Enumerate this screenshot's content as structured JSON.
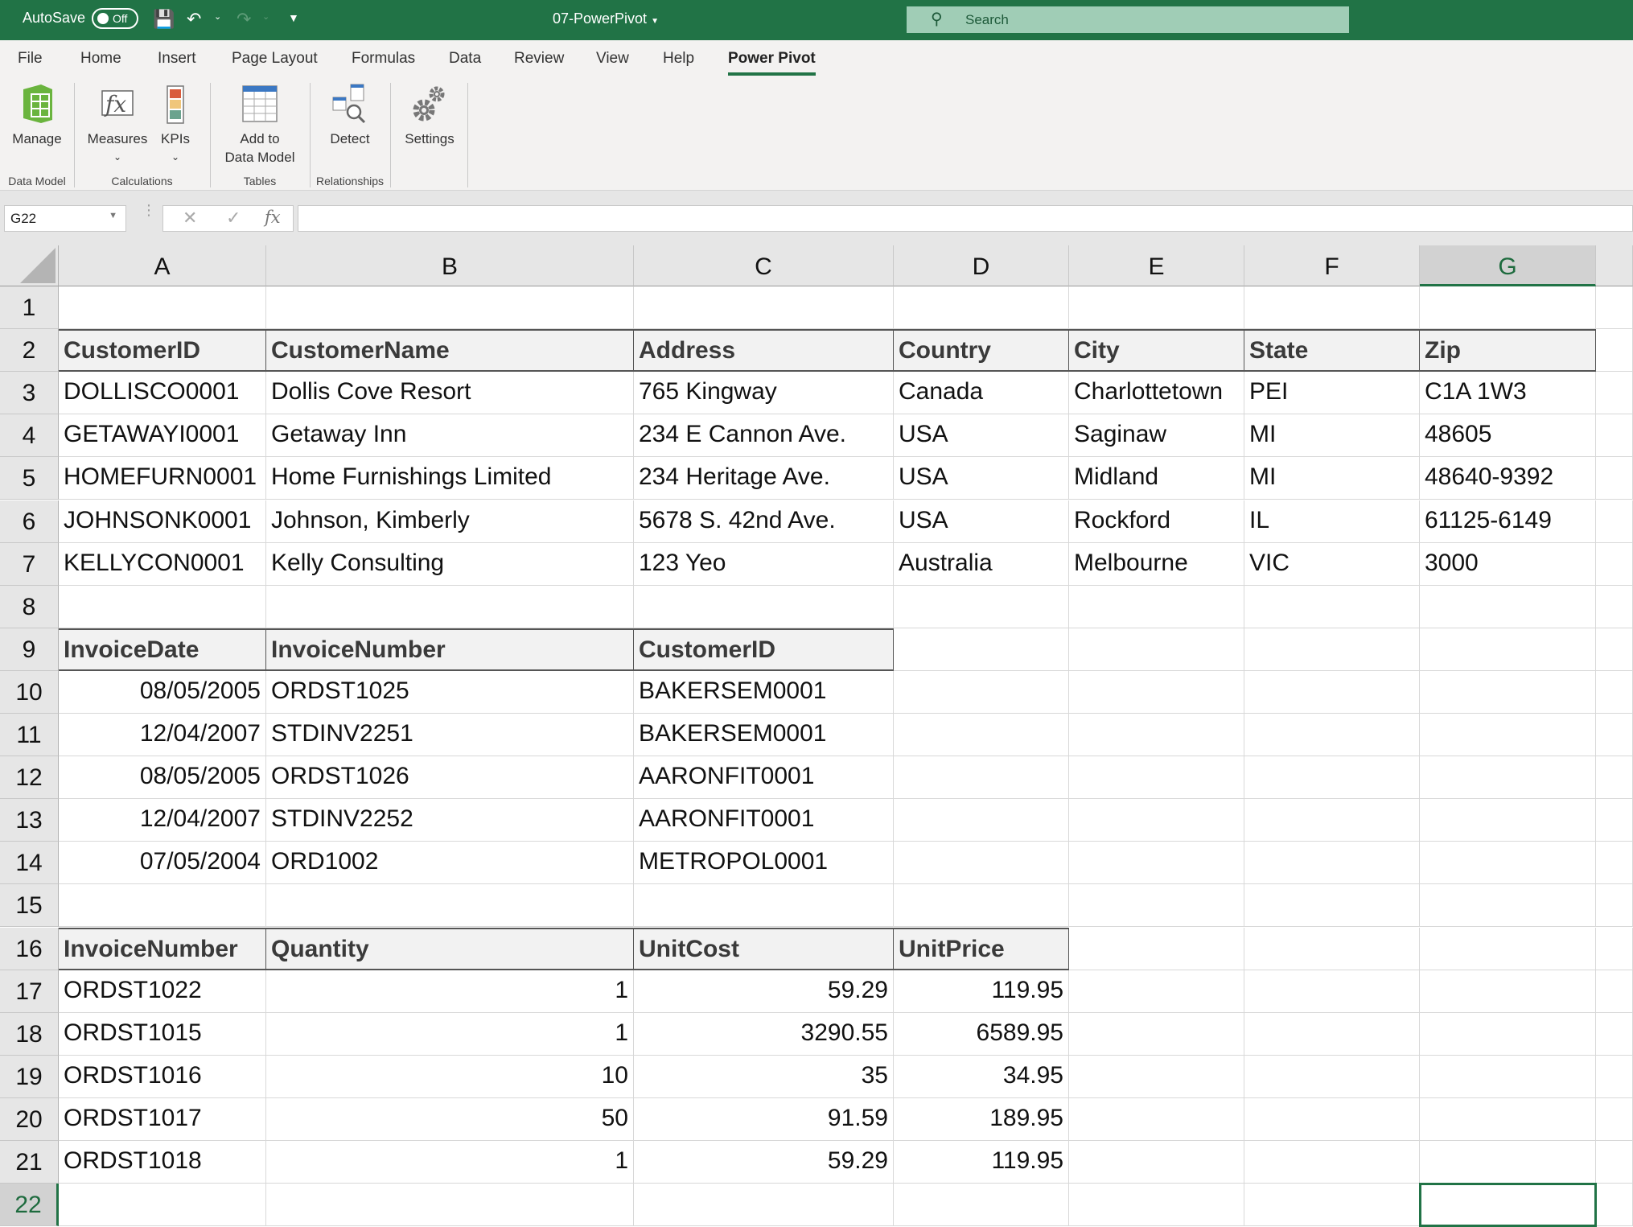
{
  "titlebar": {
    "autosave_label": "AutoSave",
    "autosave_state": "Off",
    "document_title": "07-PowerPivot",
    "search_placeholder": "Search",
    "brand_color": "#217346"
  },
  "tabs": [
    {
      "label": "File"
    },
    {
      "label": "Home"
    },
    {
      "label": "Insert"
    },
    {
      "label": "Page Layout"
    },
    {
      "label": "Formulas"
    },
    {
      "label": "Data"
    },
    {
      "label": "Review"
    },
    {
      "label": "View"
    },
    {
      "label": "Help"
    },
    {
      "label": "Power Pivot",
      "active": true
    }
  ],
  "ribbon": {
    "buttons": {
      "manage": "Manage",
      "measures": "Measures",
      "kpis": "KPIs",
      "add_to": "Add to",
      "data_model": "Data Model",
      "detect": "Detect",
      "settings": "Settings"
    },
    "groups": {
      "data_model": "Data Model",
      "calculations": "Calculations",
      "tables": "Tables",
      "relationships": "Relationships"
    }
  },
  "formula_bar": {
    "name_box": "G22",
    "formula": ""
  },
  "sheet": {
    "columns": [
      "A",
      "B",
      "C",
      "D",
      "E",
      "F",
      "G"
    ],
    "selected_cell": "G22",
    "rows": [
      "1",
      "2",
      "3",
      "4",
      "5",
      "6",
      "7",
      "8",
      "9",
      "10",
      "11",
      "12",
      "13",
      "14",
      "15",
      "16",
      "17",
      "18",
      "19",
      "20",
      "21",
      "22"
    ],
    "customers": {
      "headers": [
        "CustomerID",
        "CustomerName",
        "Address",
        "Country",
        "City",
        "State",
        "Zip"
      ],
      "rows": [
        [
          "DOLLISCO0001",
          "Dollis Cove Resort",
          "765 Kingway",
          "Canada",
          "Charlottetown",
          "PEI",
          "C1A 1W3"
        ],
        [
          "GETAWAYI0001",
          "Getaway Inn",
          "234 E Cannon Ave.",
          "USA",
          "Saginaw",
          "MI",
          "48605"
        ],
        [
          "HOMEFURN0001",
          "Home Furnishings Limited",
          "234 Heritage Ave.",
          "USA",
          "Midland",
          "MI",
          "48640-9392"
        ],
        [
          "JOHNSONK0001",
          "Johnson, Kimberly",
          "5678 S. 42nd Ave.",
          "USA",
          "Rockford",
          "IL",
          "61125-6149"
        ],
        [
          "KELLYCON0001",
          "Kelly Consulting",
          "123 Yeo",
          "Australia",
          "Melbourne",
          "VIC",
          "3000"
        ]
      ]
    },
    "invoices": {
      "headers": [
        "InvoiceDate",
        "InvoiceNumber",
        "CustomerID"
      ],
      "rows": [
        [
          "08/05/2005",
          "ORDST1025",
          "BAKERSEM0001"
        ],
        [
          "12/04/2007",
          "STDINV2251",
          "BAKERSEM0001"
        ],
        [
          "08/05/2005",
          "ORDST1026",
          "AARONFIT0001"
        ],
        [
          "12/04/2007",
          "STDINV2252",
          "AARONFIT0001"
        ],
        [
          "07/05/2004",
          "ORD1002",
          "METROPOL0001"
        ]
      ]
    },
    "lines": {
      "headers": [
        "InvoiceNumber",
        "Quantity",
        "UnitCost",
        "UnitPrice"
      ],
      "rows": [
        [
          "ORDST1022",
          "1",
          "59.29",
          "119.95"
        ],
        [
          "ORDST1015",
          "1",
          "3290.55",
          "6589.95"
        ],
        [
          "ORDST1016",
          "10",
          "35",
          "34.95"
        ],
        [
          "ORDST1017",
          "50",
          "91.59",
          "189.95"
        ],
        [
          "ORDST1018",
          "1",
          "59.29",
          "119.95"
        ]
      ]
    }
  }
}
